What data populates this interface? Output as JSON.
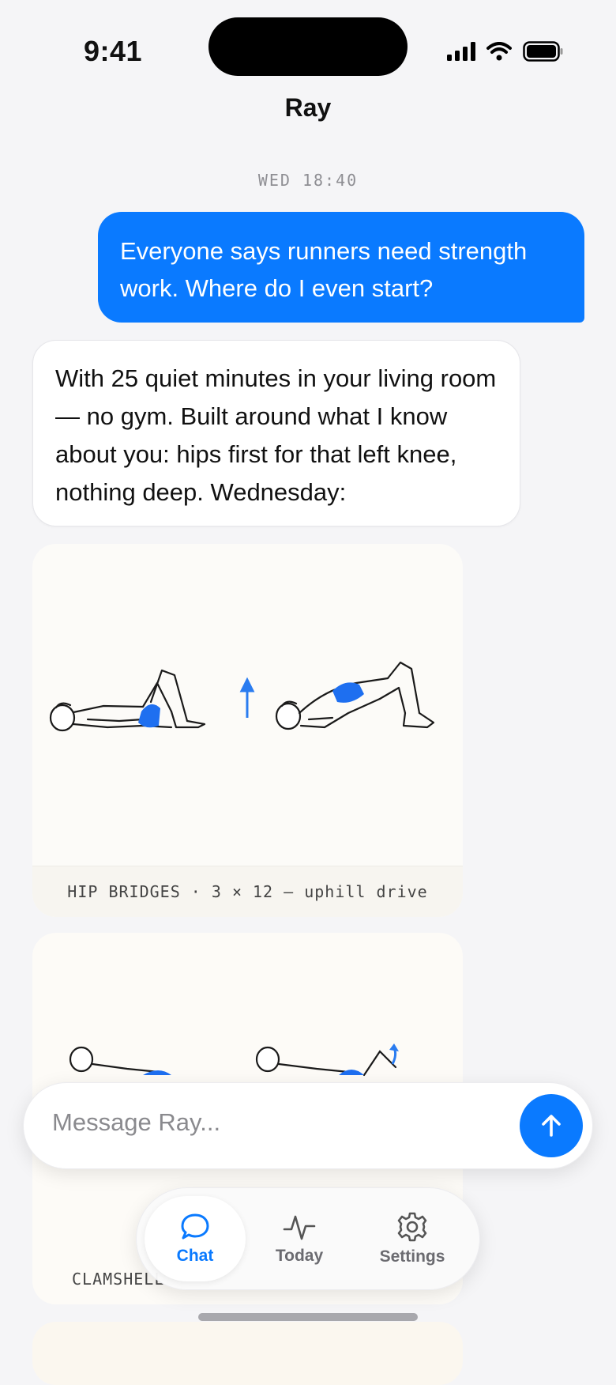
{
  "status": {
    "time": "9:41"
  },
  "header": {
    "title": "Ray"
  },
  "conversation": {
    "timestamp": "WED 18:40",
    "messages": [
      {
        "role": "user",
        "text": "Everyone says runners need strength work. Where do I even start?"
      },
      {
        "role": "assistant",
        "text": "With 25 quiet minutes in your living room — no gym. Built around what I know about you: hips first for that left knee, nothing deep. Wednesday:"
      }
    ],
    "exercises": [
      {
        "caption": "HIP BRIDGES · 3 × 12 — uphill drive"
      },
      {
        "caption": "CLAMSHELL"
      }
    ]
  },
  "composer": {
    "placeholder": "Message Ray..."
  },
  "tabbar": {
    "tabs": [
      {
        "label": "Chat"
      },
      {
        "label": "Today"
      },
      {
        "label": "Settings"
      }
    ]
  },
  "colors": {
    "accent": "#0a7aff",
    "background": "#f5f5f7",
    "card": "#fcfbf8"
  }
}
